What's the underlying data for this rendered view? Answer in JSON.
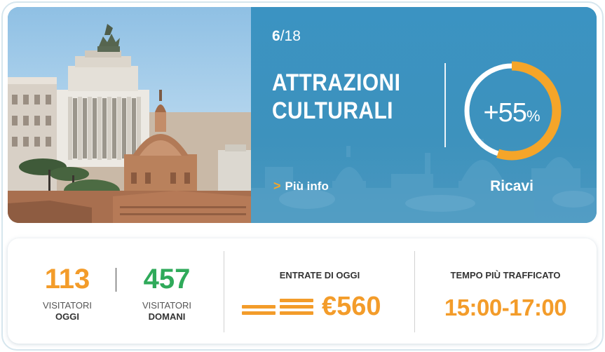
{
  "colors": {
    "panel_blue": "#3d94c0",
    "accent_orange": "#f39c2a",
    "accent_green": "#2faa5a",
    "frame_border": "#d6e6ee"
  },
  "slide": {
    "current": "6",
    "separator": "/",
    "total": "18"
  },
  "title_line1": "ATTRAZIONI",
  "title_line2": "CULTURALI",
  "more_link": {
    "icon": "chevron-right-icon",
    "label": "Più info"
  },
  "revenue_gauge": {
    "value": "+55",
    "unit": "%",
    "label": "Ricavi",
    "fraction": 0.55
  },
  "visitors": {
    "today": {
      "value": "113",
      "label_line1": "VISITATORI",
      "label_line2": "OGGI"
    },
    "tomorrow": {
      "value": "457",
      "label_line1": "VISITATORI",
      "label_line2": "DOMANI"
    }
  },
  "revenue_today": {
    "title": "ENTRATE DI OGGI",
    "value": "€560",
    "icon": "money-bars-icon"
  },
  "busiest_time": {
    "title": "TEMPO PIÙ TRAFFICATO",
    "value": "15:00-17:00"
  }
}
